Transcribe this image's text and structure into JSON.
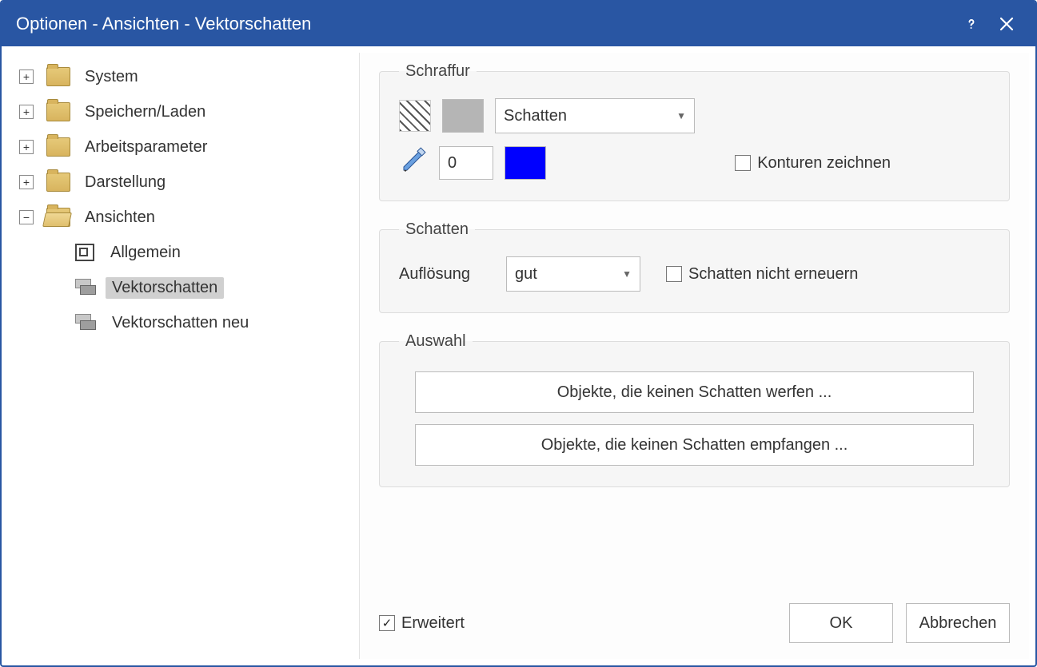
{
  "title": "Optionen - Ansichten - Vektorschatten",
  "tree": {
    "items": [
      {
        "label": "System",
        "type": "folder",
        "expandable": true,
        "expanded": false
      },
      {
        "label": "Speichern/Laden",
        "type": "folder",
        "expandable": true,
        "expanded": false
      },
      {
        "label": "Arbeitsparameter",
        "type": "folder",
        "expandable": true,
        "expanded": false
      },
      {
        "label": "Darstellung",
        "type": "folder",
        "expandable": true,
        "expanded": false
      },
      {
        "label": "Ansichten",
        "type": "folder-open",
        "expandable": true,
        "expanded": true,
        "children": [
          {
            "label": "Allgemein",
            "icon": "doc"
          },
          {
            "label": "Vektorschatten",
            "icon": "cubes",
            "selected": true
          },
          {
            "label": "Vektorschatten neu",
            "icon": "cubes"
          }
        ]
      }
    ]
  },
  "groups": {
    "schraffur": {
      "legend": "Schraffur",
      "layer_dropdown": {
        "value": "Schatten"
      },
      "pen_width": "0",
      "pen_color": "#0000ff",
      "fill_color": "#b5b5b5",
      "draw_contours": {
        "label": "Konturen zeichnen",
        "checked": false
      }
    },
    "schatten": {
      "legend": "Schatten",
      "resolution_label": "Auflösung",
      "resolution": {
        "value": "gut"
      },
      "no_refresh": {
        "label": "Schatten nicht erneuern",
        "checked": false
      }
    },
    "auswahl": {
      "legend": "Auswahl",
      "btn_cast": "Objekte, die keinen Schatten werfen ...",
      "btn_receive": "Objekte, die keinen Schatten empfangen ..."
    }
  },
  "footer": {
    "extended": {
      "label": "Erweitert",
      "checked": true
    },
    "ok": "OK",
    "cancel": "Abbrechen"
  }
}
